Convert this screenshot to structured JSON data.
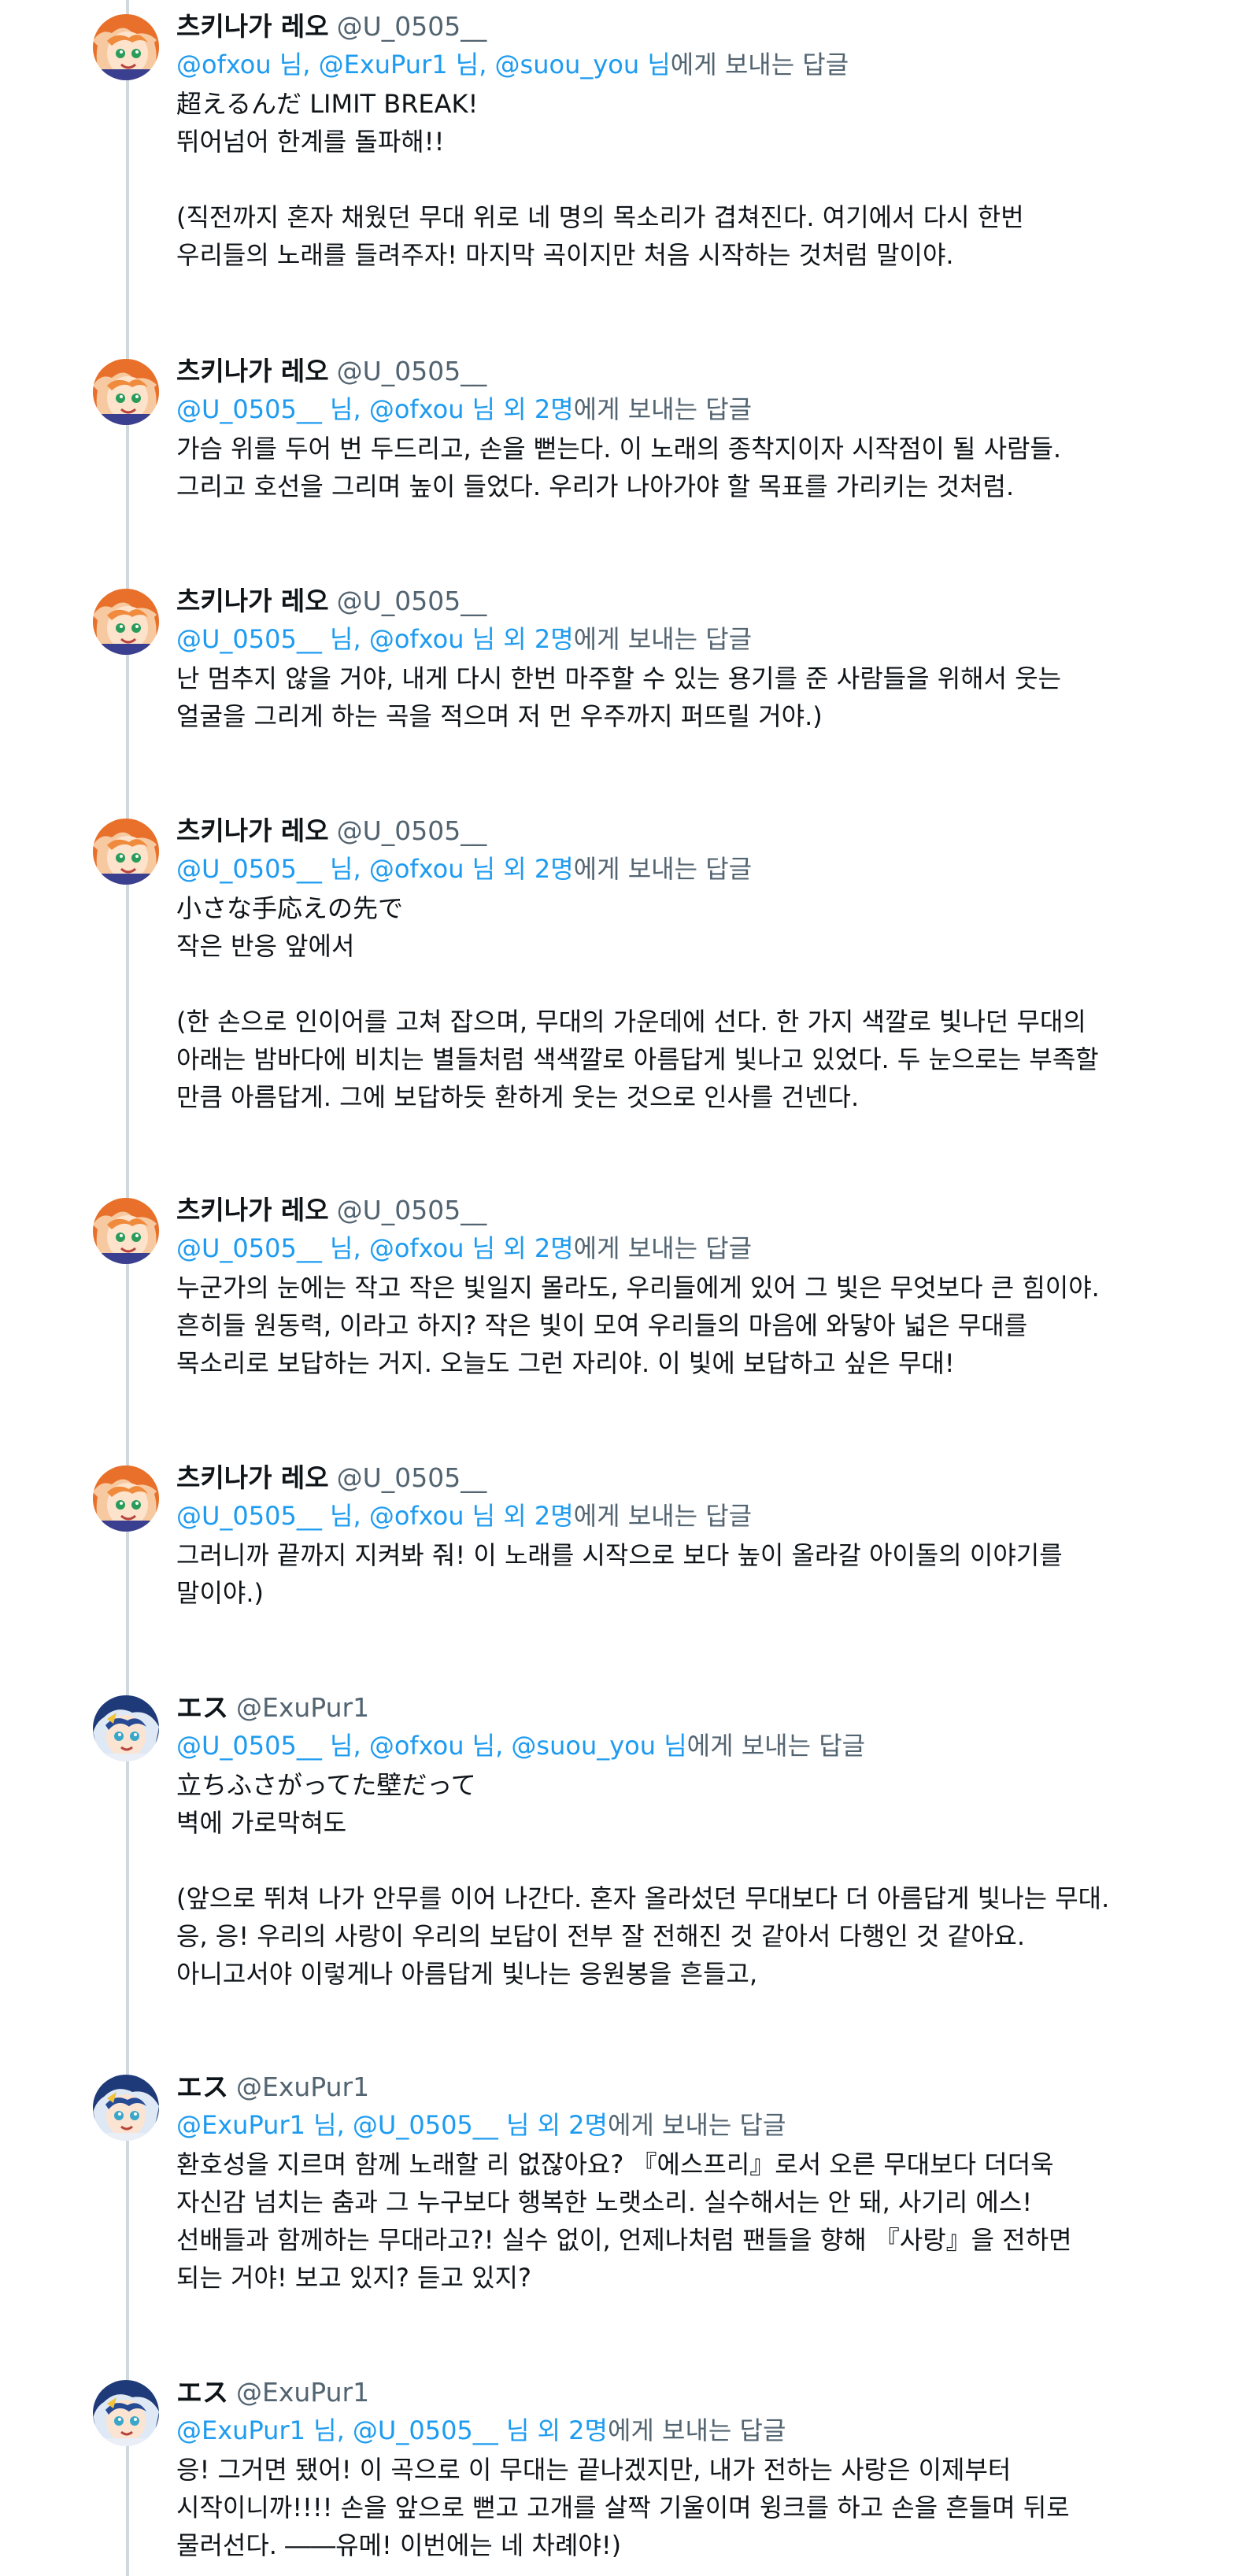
{
  "tweets": [
    {
      "avatar": "leo",
      "name": "츠키나가 레오",
      "handle": "@U_0505__",
      "reply_links": "@ofxou 님, @ExuPur1 님, @suou_you 님",
      "reply_suffix": "에게 보내는 답글",
      "text": "超えるんだ LIMIT BREAK!\n뛰어넘어 한계를 돌파해!!\n\n(직전까지 혼자 채웠던 무대 위로 네 명의 목소리가 겹쳐진다. 여기에서 다시 한번\n우리들의 노래를 들려주자! 마지막 곡이지만 처음 시작하는 것처럼 말이야."
    },
    {
      "avatar": "leo",
      "name": "츠키나가 레오",
      "handle": "@U_0505__",
      "reply_links": "@U_0505__ 님, @ofxou 님 외 2명",
      "reply_suffix": "에게 보내는 답글",
      "text": "가슴 위를 두어 번 두드리고, 손을 뻗는다. 이 노래의 종착지이자 시작점이 될 사람들.\n그리고 호선을 그리며 높이 들었다. 우리가 나아가야 할 목표를 가리키는 것처럼."
    },
    {
      "avatar": "leo",
      "name": "츠키나가 레오",
      "handle": "@U_0505__",
      "reply_links": "@U_0505__ 님, @ofxou 님 외 2명",
      "reply_suffix": "에게 보내는 답글",
      "text": "난 멈추지 않을 거야, 내게 다시 한번 마주할 수 있는 용기를 준 사람들을 위해서 웃는\n얼굴을 그리게 하는 곡을 적으며 저 먼 우주까지 퍼뜨릴 거야.)"
    },
    {
      "avatar": "leo",
      "name": "츠키나가 레오",
      "handle": "@U_0505__",
      "reply_links": "@U_0505__ 님, @ofxou 님 외 2명",
      "reply_suffix": "에게 보내는 답글",
      "text": "小さな手応えの先で\n작은 반응 앞에서\n\n(한 손으로 인이어를 고쳐 잡으며, 무대의 가운데에 선다. 한 가지 색깔로 빛나던 무대의\n아래는 밤바다에 비치는 별들처럼 색색깔로 아름답게 빛나고 있었다. 두 눈으로는 부족할\n만큼 아름답게. 그에 보답하듯 환하게 웃는 것으로 인사를 건넨다."
    },
    {
      "avatar": "leo",
      "name": "츠키나가 레오",
      "handle": "@U_0505__",
      "reply_links": "@U_0505__ 님, @ofxou 님 외 2명",
      "reply_suffix": "에게 보내는 답글",
      "text": "누군가의 눈에는 작고 작은 빛일지 몰라도, 우리들에게 있어 그 빛은 무엇보다 큰 힘이야.\n흔히들 원동력, 이라고 하지? 작은 빛이 모여 우리들의 마음에 와닿아 넓은 무대를\n목소리로 보답하는 거지. 오늘도 그런 자리야. 이 빛에 보답하고 싶은 무대!"
    },
    {
      "avatar": "leo",
      "name": "츠키나가 레오",
      "handle": "@U_0505__",
      "reply_links": "@U_0505__ 님, @ofxou 님 외 2명",
      "reply_suffix": "에게 보내는 답글",
      "text": "그러니까 끝까지 지켜봐 줘! 이 노래를 시작으로 보다 높이 올라갈 아이돌의 이야기를\n말이야.)"
    },
    {
      "avatar": "es",
      "name": "エス",
      "handle": "@ExuPur1",
      "reply_links": "@U_0505__ 님, @ofxou 님, @suou_you 님",
      "reply_suffix": "에게 보내는 답글",
      "text": "立ちふさがってた壁だって\n벽에 가로막혀도\n\n(앞으로 뛰쳐 나가 안무를 이어 나간다. 혼자 올라섰던 무대보다 더 아름답게 빛나는 무대.\n응, 응! 우리의 사랑이 우리의 보답이 전부 잘 전해진 것 같아서 다행인 것 같아요.\n아니고서야 이렇게나 아름답게 빛나는 응원봉을 흔들고,"
    },
    {
      "avatar": "es",
      "name": "エス",
      "handle": "@ExuPur1",
      "reply_links": "@ExuPur1 님, @U_0505__ 님 외 2명",
      "reply_suffix": "에게 보내는 답글",
      "text": "환호성을 지르며 함께 노래할 리 없잖아요? 『에스프리』로서 오른 무대보다 더더욱\n자신감 넘치는 춤과 그 누구보다 행복한 노랫소리. 실수해서는 안 돼, 사기리 에스!\n선배들과 함께하는 무대라고?! 실수 없이, 언제나처럼 팬들을 향해 『사랑』을 전하면\n되는 거야! 보고 있지? 듣고 있지?"
    },
    {
      "avatar": "es",
      "name": "エス",
      "handle": "@ExuPur1",
      "reply_links": "@ExuPur1 님, @U_0505__ 님 외 2명",
      "reply_suffix": "에게 보내는 답글",
      "text": "응! 그거면 됐어! 이 곡으로 이 무대는 끝나겠지만, 내가 전하는 사랑은 이제부터\n시작이니까!!!! 손을 앞으로 뻗고 고개를 살짝 기울이며 윙크를 하고 손을 흔들며 뒤로\n물러선다. ――유메! 이번에는 네 차례야!)"
    }
  ]
}
